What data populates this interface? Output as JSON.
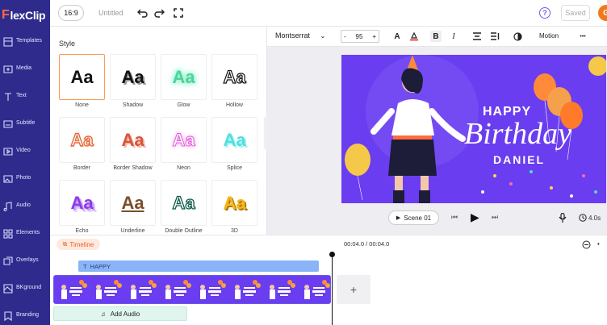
{
  "app": {
    "logo_text": "lexClip"
  },
  "sidebar": {
    "items": [
      {
        "label": "Templates",
        "icon": "template-icon"
      },
      {
        "label": "Media",
        "icon": "media-icon"
      },
      {
        "label": "Text",
        "icon": "text-icon"
      },
      {
        "label": "Subtitle",
        "icon": "subtitle-icon"
      },
      {
        "label": "Video",
        "icon": "video-icon"
      },
      {
        "label": "Photo",
        "icon": "photo-icon"
      },
      {
        "label": "Audio",
        "icon": "audio-icon"
      },
      {
        "label": "Elements",
        "icon": "elements-icon"
      },
      {
        "label": "Overlays",
        "icon": "overlays-icon"
      },
      {
        "label": "BKground",
        "icon": "background-icon"
      },
      {
        "label": "Branding",
        "icon": "branding-icon"
      }
    ]
  },
  "topbar": {
    "ratio": "16:9",
    "project_name": "Untitled",
    "help": "?",
    "saved": "Saved",
    "avatar": "G"
  },
  "style_panel": {
    "title": "Style",
    "sample": "Aa",
    "styles": [
      "None",
      "Shadow",
      "Glow",
      "Hollow",
      "Border",
      "Border Shadow",
      "Neon",
      "Splice",
      "Echo",
      "Underline",
      "Double Outline",
      "3D"
    ]
  },
  "text_toolbar": {
    "font": "Montserrat",
    "size": "95",
    "minus": "-",
    "plus": "+",
    "bold": "B",
    "italic": "I",
    "motion": "Motion",
    "more": "•••"
  },
  "canvas": {
    "line1": "HAPPY",
    "line2": "Birthday",
    "line3": "DANIEL"
  },
  "player": {
    "scene": "Scene 01",
    "time": "4.0s"
  },
  "timeline": {
    "label": "Timeline",
    "time": "00:04.0 / 00:04.0",
    "text_track": "HAPPY",
    "add_audio": "Add Audio",
    "add_scene": "+"
  },
  "colors": {
    "sidebar": "#2e2b8c",
    "canvas": "#6a3df0",
    "accent": "#ff6a3d"
  }
}
